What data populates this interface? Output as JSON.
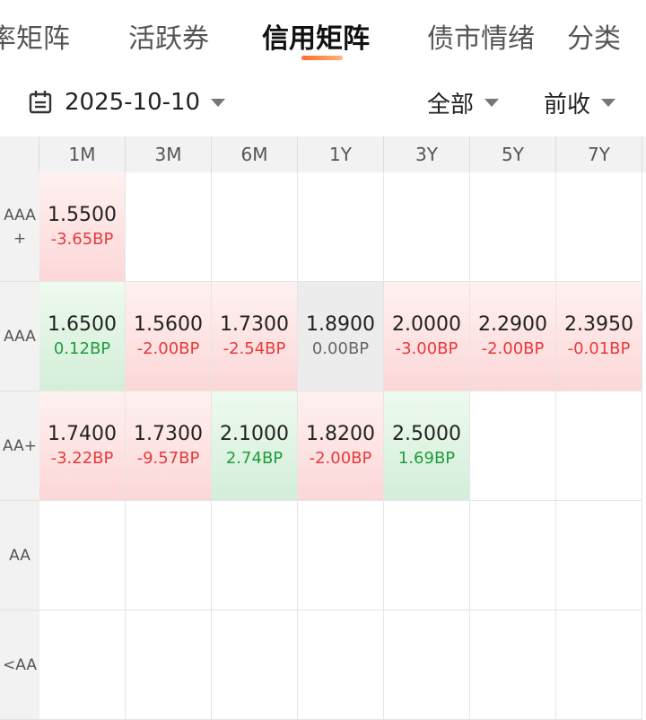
{
  "tabs": [
    {
      "label": "率矩阵"
    },
    {
      "label": "活跃券"
    },
    {
      "label": "信用矩阵"
    },
    {
      "label": "债市情绪"
    },
    {
      "label": "分类"
    }
  ],
  "active_tab_index": 2,
  "toolbar": {
    "date": "2025-10-10",
    "date_icon": "calendar-icon",
    "filter_scope": "全部",
    "filter_compare": "前收"
  },
  "matrix": {
    "columns": [
      "1M",
      "3M",
      "6M",
      "1Y",
      "3Y",
      "5Y",
      "7Y"
    ],
    "rows": [
      {
        "label": "AAA+",
        "cells": [
          {
            "value": "1.5500",
            "change": "-3.65BP",
            "trend": "down"
          },
          null,
          null,
          null,
          null,
          null,
          null
        ]
      },
      {
        "label": "AAA",
        "cells": [
          {
            "value": "1.6500",
            "change": "0.12BP",
            "trend": "up"
          },
          {
            "value": "1.5600",
            "change": "-2.00BP",
            "trend": "down"
          },
          {
            "value": "1.7300",
            "change": "-2.54BP",
            "trend": "down"
          },
          {
            "value": "1.8900",
            "change": "0.00BP",
            "trend": "flat"
          },
          {
            "value": "2.0000",
            "change": "-3.00BP",
            "trend": "down"
          },
          {
            "value": "2.2900",
            "change": "-2.00BP",
            "trend": "down"
          },
          {
            "value": "2.3950",
            "change": "-0.01BP",
            "trend": "down"
          }
        ]
      },
      {
        "label": "AA+",
        "cells": [
          {
            "value": "1.7400",
            "change": "-3.22BP",
            "trend": "down"
          },
          {
            "value": "1.7300",
            "change": "-9.57BP",
            "trend": "down"
          },
          {
            "value": "2.1000",
            "change": "2.74BP",
            "trend": "up"
          },
          {
            "value": "1.8200",
            "change": "-2.00BP",
            "trend": "down"
          },
          {
            "value": "2.5000",
            "change": "1.69BP",
            "trend": "up"
          },
          null,
          null
        ]
      },
      {
        "label": "AA",
        "cells": [
          null,
          null,
          null,
          null,
          null,
          null,
          null
        ]
      },
      {
        "label": "<AA",
        "cells": [
          null,
          null,
          null,
          null,
          null,
          null,
          null
        ]
      }
    ]
  },
  "colors": {
    "accent": "#ff6a2a",
    "down": "#e8393b",
    "up": "#1f9d3a",
    "flat": "#666666"
  }
}
